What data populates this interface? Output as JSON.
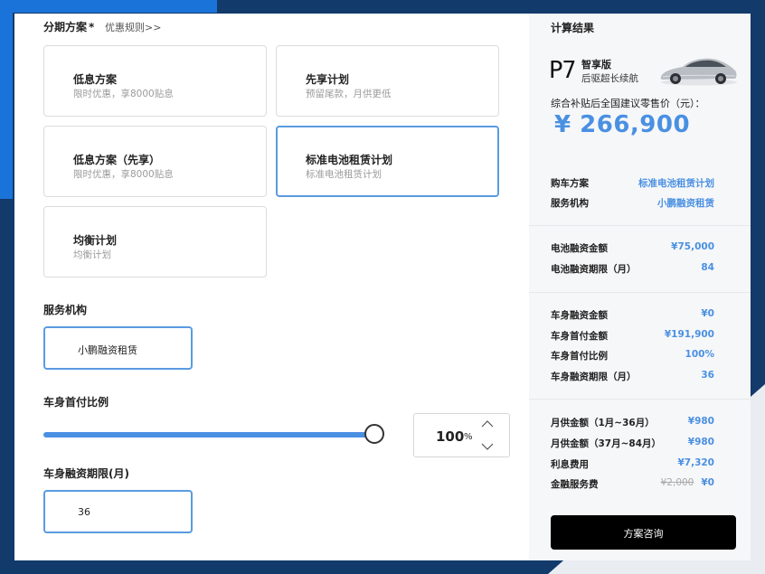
{
  "plan_section": {
    "title": "分期方案",
    "required_mark": "*",
    "rules_link": "优惠规则>>",
    "plans": [
      {
        "name": "低息方案",
        "desc": "限时优惠，享8000贴息",
        "selected": false
      },
      {
        "name": "先享计划",
        "desc": "预留尾款，月供更低",
        "selected": false
      },
      {
        "name": "低息方案（先享）",
        "desc": "限时优惠，享8000贴息",
        "selected": false
      },
      {
        "name": "标准电池租赁计划",
        "desc": "标准电池租赁计划",
        "selected": true
      },
      {
        "name": "均衡计划",
        "desc": "均衡计划",
        "selected": false
      }
    ]
  },
  "service_section": {
    "title": "服务机构",
    "option": "小鹏融资租赁"
  },
  "downpay_section": {
    "title": "车身首付比例",
    "value": "100",
    "unit": "%",
    "slider_fraction": 1.0
  },
  "term_section": {
    "title": "车身融资期限(月)",
    "value": "36"
  },
  "result": {
    "title": "计算结果",
    "logo": "P7",
    "model_name": "智享版",
    "model_sub": "后驱超长续航",
    "price_label": "综合补贴后全国建议零售价（元）：",
    "price": "¥ 266,900",
    "group1": [
      {
        "k": "购车方案",
        "v": "标准电池租赁计划"
      },
      {
        "k": "服务机构",
        "v": "小鹏融资租赁"
      }
    ],
    "group2": [
      {
        "k": "电池融资金额",
        "v": "¥75,000"
      },
      {
        "k": "电池融资期限（月）",
        "v": "84"
      }
    ],
    "group3": [
      {
        "k": "车身融资金额",
        "v": "¥0"
      },
      {
        "k": "车身首付金额",
        "v": "¥191,900"
      },
      {
        "k": "车身首付比例",
        "v": "100%"
      },
      {
        "k": "车身融资期限（月）",
        "v": "36"
      }
    ],
    "group4": [
      {
        "k": "月供金额（1月~36月）",
        "v": "¥980"
      },
      {
        "k": "月供金额（37月~84月）",
        "v": "¥980"
      },
      {
        "k": "利息费用",
        "v": "¥7,320"
      },
      {
        "k": "金融服务费",
        "strike": "¥2,000",
        "v": "¥0"
      }
    ],
    "consult_button": "方案咨询"
  },
  "colors": {
    "accent": "#4a90e2",
    "button": "#000000",
    "selected_border": "#5a9be0"
  }
}
